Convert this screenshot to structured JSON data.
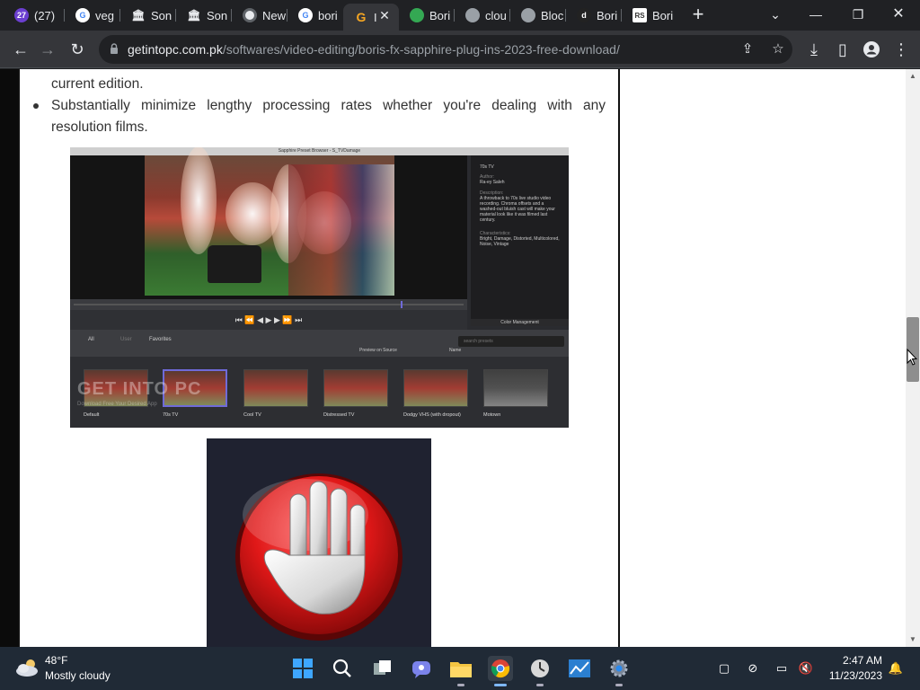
{
  "browser": {
    "tabs": [
      {
        "label": "(27)",
        "favicon": "yahoo-mail-icon",
        "color": "#6b3fd0"
      },
      {
        "label": "veg",
        "favicon": "google-icon",
        "color": "#ffffff"
      },
      {
        "label": "Son",
        "favicon": "bank-icon",
        "color": "#ffffff"
      },
      {
        "label": "Son",
        "favicon": "bank-icon",
        "color": "#ffffff"
      },
      {
        "label": "New",
        "favicon": "chrome-icon",
        "color": "#ffffff"
      },
      {
        "label": "bori",
        "favicon": "google-icon",
        "color": "#ffffff"
      },
      {
        "label": "I",
        "favicon": "getintopc-icon",
        "color": "#f5a623",
        "active": true
      },
      {
        "label": "Bori",
        "favicon": "chrome-web-icon",
        "color": "#34a853"
      },
      {
        "label": "clou",
        "favicon": "globe-icon",
        "color": "#9aa0a6"
      },
      {
        "label": "Bloc",
        "favicon": "globe-icon",
        "color": "#9aa0a6"
      },
      {
        "label": "Bori",
        "favicon": "d-icon",
        "color": "#222222"
      },
      {
        "label": "Bori",
        "favicon": "rs-icon",
        "color": "#ffffff"
      }
    ],
    "url_host": "getintopc.com.pk",
    "url_path": "/softwares/video-editing/boris-fx-sapphire-plug-ins-2023-free-download/"
  },
  "article": {
    "line_partial": "current edition.",
    "bullet_line1": "Substantially minimize lengthy processing rates whether you're dealing with any",
    "bullet_line2": "resolution films."
  },
  "screenshot": {
    "title": "Sapphire Preset Browser - S_TVDamage",
    "info_name": "70s TV",
    "info_author_label": "Author:",
    "info_author": "Ra-ey Saleh",
    "info_desc_label": "Description:",
    "info_desc": "A throwback to 70s live studio video recording. Chroma offsets and a washed-out bluish cast will make your material look like it was filmed last century.",
    "info_char_label": "Characteristics:",
    "info_char": "Bright, Damage, Distorted, Multicolored, Noise, Vintage",
    "color_mgmt": "Color Management",
    "tab_all": "All",
    "tab_user": "User",
    "tab_fav": "Favorites",
    "preview_label": "Preview on Source",
    "sort_label": "Name",
    "search_placeholder": "search presets",
    "thumbs": [
      "Default",
      "70s TV",
      "Cool TV",
      "Distressed TV",
      "Dodgy VHS (with dropout)",
      "Motown"
    ],
    "watermark": "GET INTO PC",
    "watermark_sub": "Download Free Your Desired App"
  },
  "taskbar": {
    "temperature": "48°F",
    "weather": "Mostly cloudy",
    "time": "2:47 AM",
    "date": "11/23/2023"
  }
}
